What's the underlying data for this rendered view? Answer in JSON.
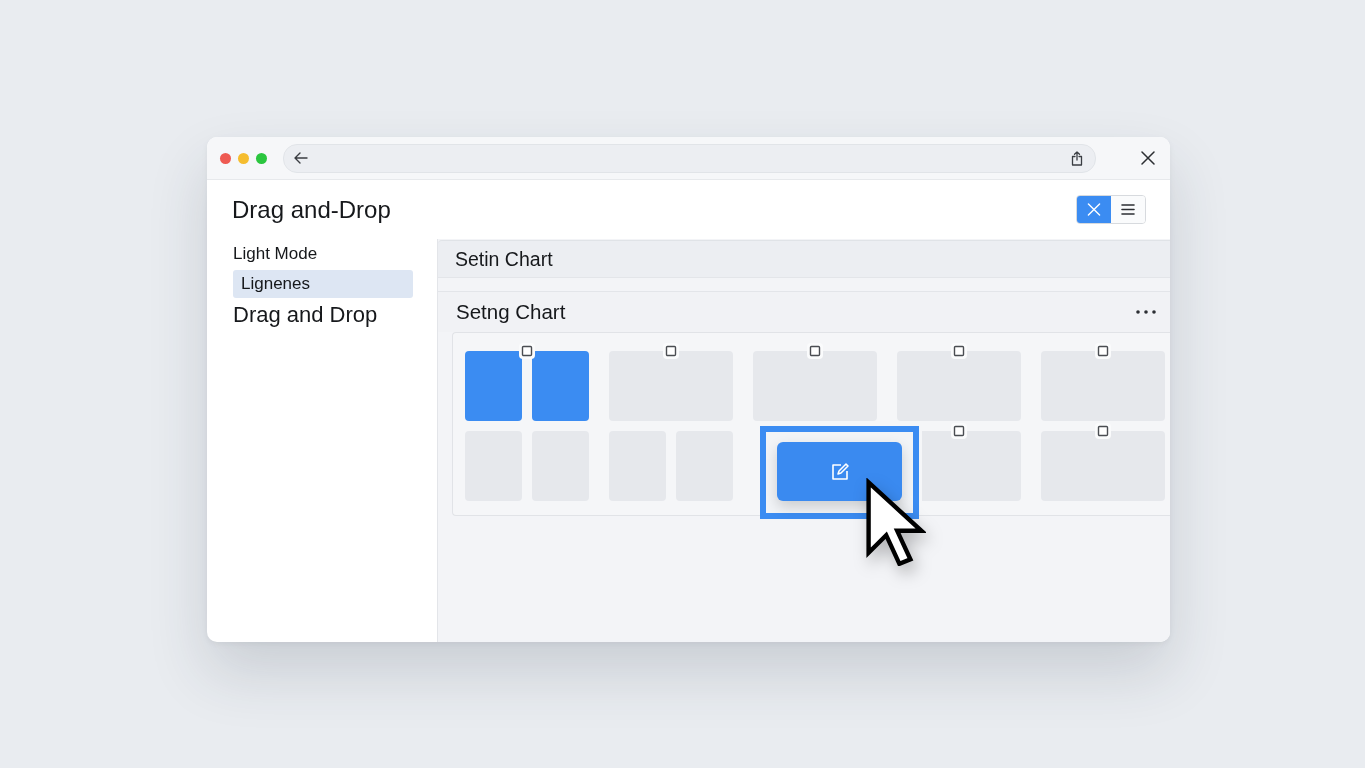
{
  "page": {
    "title": "Drag and-Drop"
  },
  "view_toggle": [
    {
      "kind": "close",
      "selected": true
    },
    {
      "kind": "menu",
      "selected": false
    }
  ],
  "sidebar": {
    "items": [
      {
        "label": "Light Mode",
        "kind": "item",
        "selected": false
      },
      {
        "label": "Lignenes",
        "kind": "item",
        "selected": true
      },
      {
        "label": "Drag and Drop",
        "kind": "heading",
        "selected": false
      }
    ]
  },
  "panels": [
    {
      "title": "Setin Chart",
      "kind": "bar"
    },
    {
      "title": "Setng Chart",
      "kind": "board",
      "board": {
        "groups": [
          {
            "rows": [
              {
                "kind": "tiles",
                "handle": true,
                "tiles": [
                  {
                    "selected": true
                  },
                  {
                    "selected": true
                  }
                ]
              },
              {
                "kind": "tiles",
                "handle": false,
                "tiles": [
                  {
                    "selected": false
                  },
                  {
                    "selected": false
                  }
                ]
              }
            ]
          },
          {
            "rows": [
              {
                "kind": "tiles",
                "handle": true,
                "tiles": [
                  {
                    "selected": false
                  }
                ]
              },
              {
                "kind": "tiles",
                "handle": false,
                "tiles": [
                  {
                    "selected": false
                  },
                  {
                    "selected": false
                  }
                ]
              }
            ]
          },
          {
            "rows": [
              {
                "kind": "tiles",
                "handle": true,
                "tiles": [
                  {
                    "selected": false
                  }
                ]
              },
              {
                "kind": "drop_target"
              }
            ]
          },
          {
            "rows": [
              {
                "kind": "tiles",
                "handle": true,
                "tiles": [
                  {
                    "selected": false
                  }
                ]
              },
              {
                "kind": "tiles",
                "handle": true,
                "tiles": [
                  {
                    "selected": false
                  }
                ]
              }
            ]
          },
          {
            "rows": [
              {
                "kind": "tiles",
                "handle": true,
                "tiles": [
                  {
                    "selected": false
                  }
                ]
              },
              {
                "kind": "tiles",
                "handle": true,
                "tiles": [
                  {
                    "selected": false
                  }
                ]
              }
            ]
          }
        ]
      }
    }
  ]
}
